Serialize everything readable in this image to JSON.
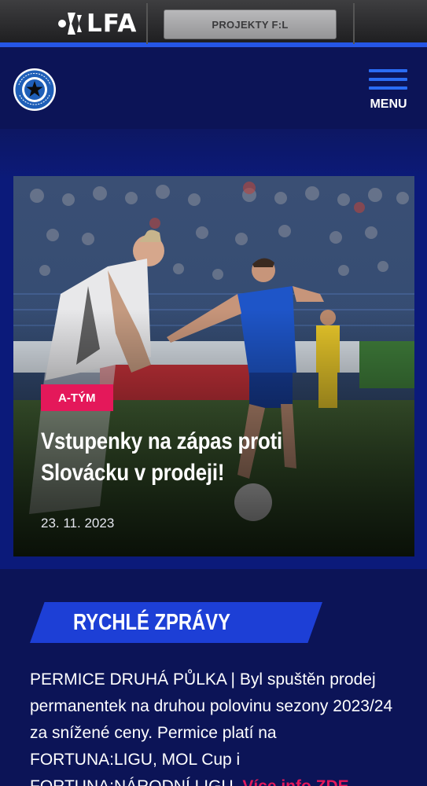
{
  "topbar": {
    "logo_text": "LFA",
    "projects_button": "PROJEKTY F:L"
  },
  "header": {
    "crest": "sk-sigma-olomouc-crest",
    "menu_label": "MENU"
  },
  "featured": {
    "tag": "A-TÝM",
    "headline": "Vstupenky na zápas proti Slovácku v prodeji!",
    "date": "23. 11. 2023",
    "image": "football-match-photo"
  },
  "quick_news": {
    "title": "RYCHLÉ ZPRÁVY",
    "text": "PERMICE DRUHÁ PŮLKA | Byl spuštěn prodej permanentek na druhou polovinu sezony 2023/24 za snížené ceny. Permice platí na FORTUNA:LIGU, MOL Cup i FORTUNA:NÁRODNÍ LIGU.",
    "more_link": "Více info ZDE"
  },
  "colors": {
    "brand_navy": "#0c1457",
    "accent_blue": "#2556e6",
    "tag_pink": "#e4185a"
  }
}
